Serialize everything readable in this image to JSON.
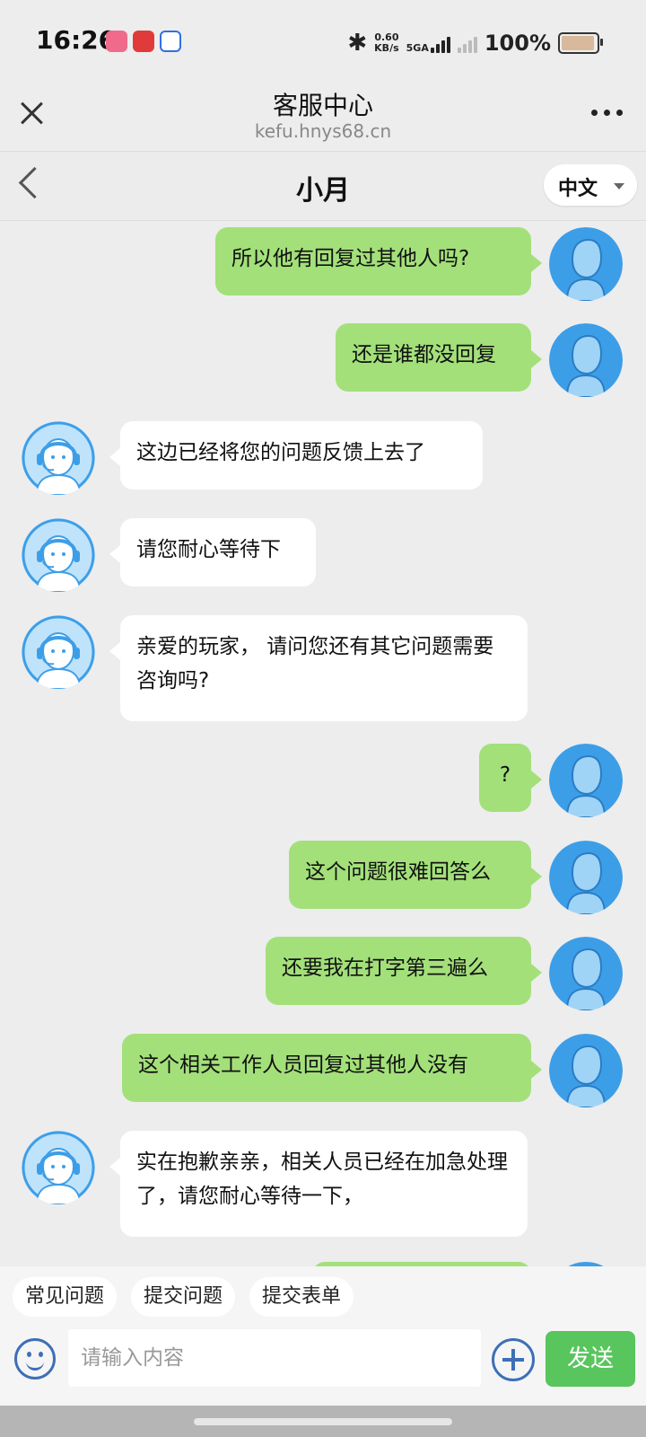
{
  "status_bar": {
    "time": "16:26",
    "net_speed_value": "0.60",
    "net_speed_unit": "KB/s",
    "network_type": "5GA",
    "battery_percent": "100%",
    "app_icons": [
      "bilibili-icon",
      "netease-music-icon",
      "browser-app-icon"
    ]
  },
  "web_header": {
    "title": "客服中心",
    "url": "kefu.hnys68.cn"
  },
  "chat_header": {
    "agent_name": "小月",
    "language": "中文"
  },
  "messages": [
    {
      "side": "out",
      "text": "所以他有回复过其他人吗?"
    },
    {
      "side": "out",
      "text": "还是谁都没回复"
    },
    {
      "side": "in",
      "text": "这边已经将您的问题反馈上去了"
    },
    {
      "side": "in",
      "text": "请您耐心等待下"
    },
    {
      "side": "in",
      "text": "亲爱的玩家， 请问您还有其它问题需要咨询吗?"
    },
    {
      "side": "out",
      "text": "?"
    },
    {
      "side": "out",
      "text": "这个问题很难回答么"
    },
    {
      "side": "out",
      "text": "还要我在打字第三遍么"
    },
    {
      "side": "out",
      "text": "这个相关工作人员回复过其他人没有"
    },
    {
      "side": "in",
      "text": "实在抱歉亲亲，相关人员已经在加急处理了，请您耐心等待一下，"
    }
  ],
  "quick_actions": [
    "常见问题",
    "提交问题",
    "提交表单"
  ],
  "input": {
    "placeholder": "请输入内容",
    "value": ""
  },
  "send_label": "发送",
  "colors": {
    "outgoing_bubble": "#a3e07a",
    "incoming_bubble": "#ffffff",
    "send_button": "#58c55d",
    "background": "#ededed"
  }
}
